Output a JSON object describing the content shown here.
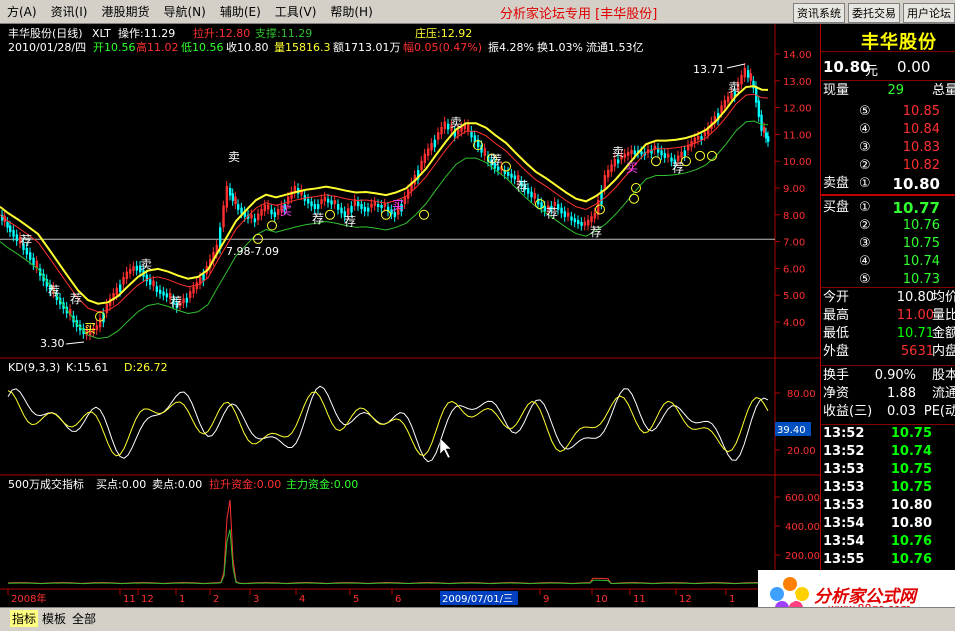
{
  "menubar": {
    "items": [
      "方(A)",
      "资讯(I)",
      "港股期货",
      "导航(N)",
      "辅助(E)",
      "工具(V)",
      "帮助(H)"
    ],
    "title": "分析家论坛专用 [丰华股份]",
    "right_buttons": [
      "资讯系统",
      "委托交易",
      "用户论坛"
    ]
  },
  "chart": {
    "header1": {
      "name": "丰华股份(日线)",
      "indicator": "XLT",
      "op_label": "操作:11.29",
      "lashen_label": "拉升:12.80",
      "zhicheng_label": "支撑:11.29",
      "zhuangya_label": "庄压:12.92"
    },
    "header2": {
      "date": "2010/01/28/四",
      "open": "开10.56",
      "high": "高11.02",
      "low": "低10.56",
      "close": "收10.80",
      "volume": "量15816.3",
      "amount": "额1713.01万",
      "amp": "幅0.05(0.47%)",
      "zhen": "振4.28%",
      "huan": "换1.03%",
      "liutong": "流通1.53亿"
    },
    "price_axis": [
      "14.00",
      "13.00",
      "12.00",
      "11.00",
      "10.00",
      "9.00",
      "8.00",
      "7.00",
      "6.00",
      "5.00",
      "4.00"
    ],
    "annotations": {
      "high_mark": "13.71",
      "low_mark": "3.30",
      "range_mark": "7.98-7.09",
      "buy_label": "买",
      "sell_label": "卖",
      "rec_label": "荐"
    },
    "kd": {
      "title": "KD(9,3,3)",
      "k": "K:15.61",
      "d": "D:26.72",
      "axis": [
        "80.00",
        "20.00"
      ],
      "marker": "39.40"
    },
    "vol": {
      "title": "500万成交指标",
      "buy": "买点:0.00",
      "sell": "卖点:0.00",
      "lashen": "拉升资金:0.00",
      "zhuli": "主力资金:0.00",
      "axis": [
        "600.00",
        "400.00",
        "200.00"
      ]
    },
    "date_axis": {
      "labels": [
        "2008年",
        "11",
        "12",
        "1",
        "2",
        "3",
        "4",
        "5",
        "6",
        "9",
        "10",
        "11",
        "12",
        "1"
      ],
      "highlight": "2009/07/01/三"
    }
  },
  "quote": {
    "stock_name": "丰华股份",
    "last_price": "10.80",
    "unit": "元",
    "change": "0.00",
    "xianliang_label": "现量",
    "xianliang": "29",
    "zongliang_label": "总量",
    "sell_label": "卖盘",
    "buy_label": "买盘",
    "sells": [
      {
        "n": "⑤",
        "p": "10.85"
      },
      {
        "n": "④",
        "p": "10.84"
      },
      {
        "n": "③",
        "p": "10.83"
      },
      {
        "n": "②",
        "p": "10.82"
      },
      {
        "n": "①",
        "p": "10.80"
      }
    ],
    "buys": [
      {
        "n": "①",
        "p": "10.77"
      },
      {
        "n": "②",
        "p": "10.76"
      },
      {
        "n": "③",
        "p": "10.75"
      },
      {
        "n": "④",
        "p": "10.74"
      },
      {
        "n": "⑤",
        "p": "10.73"
      }
    ],
    "stats": [
      {
        "l": "今开",
        "v": "10.80",
        "e": "均价",
        "c": "#ffffff"
      },
      {
        "l": "最高",
        "v": "11.00",
        "e": "量比",
        "c": "#ff3030"
      },
      {
        "l": "最低",
        "v": "10.71",
        "e": "金额",
        "c": "#00ff00"
      },
      {
        "l": "外盘",
        "v": "5631",
        "e": "内盘",
        "c": "#ff3030"
      }
    ],
    "stats2": [
      {
        "l": "换手",
        "v": "0.90%",
        "e": "股本"
      },
      {
        "l": "净资",
        "v": "1.88",
        "e": "流通"
      },
      {
        "l": "收益(三)",
        "v": "0.03",
        "e": "PE(动"
      }
    ],
    "ticks": [
      {
        "t": "13:52",
        "p": "10.75",
        "c": "#00ff00"
      },
      {
        "t": "13:52",
        "p": "10.74",
        "c": "#00ff00"
      },
      {
        "t": "13:53",
        "p": "10.75",
        "c": "#00ff00"
      },
      {
        "t": "13:53",
        "p": "10.75",
        "c": "#00ff00"
      },
      {
        "t": "13:53",
        "p": "10.80",
        "c": "#ffffff"
      },
      {
        "t": "13:54",
        "p": "10.80",
        "c": "#ffffff"
      },
      {
        "t": "13:54",
        "p": "10.76",
        "c": "#00ff00"
      },
      {
        "t": "13:55",
        "p": "10.76",
        "c": "#00ff00"
      }
    ]
  },
  "bottom": {
    "tabs": [
      "指标",
      "模板",
      "全部"
    ]
  },
  "logo": {
    "text": "分析家公式网",
    "url": "www.88gs.com"
  },
  "colors": {
    "up": "#ff3030",
    "down": "#00ffff",
    "ma_yellow": "#ffff30",
    "ma_green": "#30c030",
    "ma_red": "#ff3030"
  }
}
